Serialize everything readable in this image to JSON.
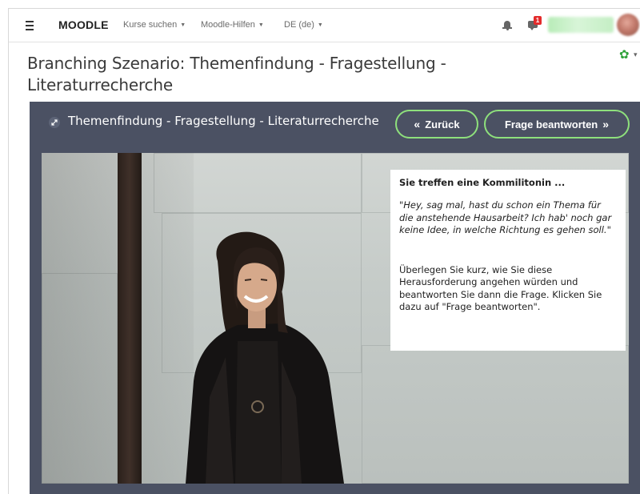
{
  "navbar": {
    "brand": "MOODLE",
    "menu": [
      {
        "label": "Kurse suchen"
      },
      {
        "label": "Moodle-Hilfen"
      },
      {
        "label": "DE (de)"
      }
    ],
    "notification_count": "1",
    "icons": {
      "menu": "hamburger-icon",
      "notifications": "bell-icon",
      "messages": "chat-icon"
    }
  },
  "page": {
    "title": "Branching Szenario: Themenfindung - Fragestellung - Literaturrecherche"
  },
  "activity": {
    "title": "Themenfindung - Fragestellung - Literaturrecherche",
    "back_button": "Zurück",
    "answer_button": "Frage beantworten",
    "back_chevron": "«",
    "answer_chevron": "»"
  },
  "dialog": {
    "heading": "Sie treffen eine Kommilitonin ...",
    "quote": "\"Hey, sag mal, hast du schon ein Thema für die anstehende Hausarbeit? Ich hab' noch gar keine Idee, in welche Richtung es gehen soll.\"",
    "instruction": "Überlegen Sie kurz, wie Sie diese Herausforderung angehen würden und beantworten Sie dann die Frage. Klicken Sie dazu auf \"Frage beantworten\"."
  },
  "colors": {
    "panel_bg": "#4b5163",
    "button_border": "#8ee07c",
    "gear": "#2fa23a",
    "badge": "#e32b2b"
  }
}
